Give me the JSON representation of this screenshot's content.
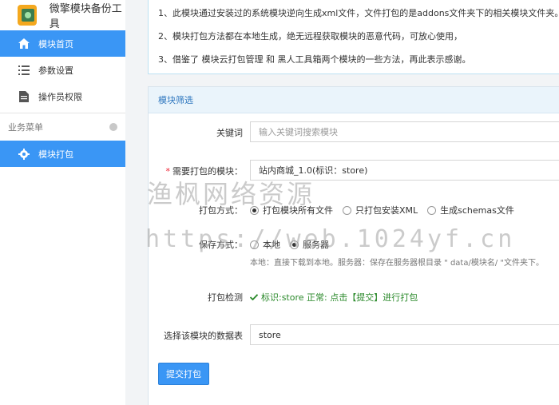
{
  "sidebar": {
    "brand_title": "微擎模块备份工具",
    "items": [
      {
        "label": "模块首页",
        "icon": "home-icon",
        "active": true
      },
      {
        "label": "参数设置",
        "icon": "list-icon",
        "active": false
      },
      {
        "label": "操作员权限",
        "icon": "document-icon",
        "active": false
      }
    ],
    "section_label": "业务菜单",
    "section_items": [
      {
        "label": "模块打包",
        "icon": "gear-icon",
        "active": true
      }
    ],
    "accent_color": "#3a96f5"
  },
  "notice": {
    "lines": [
      "1、此模块通过安装过的系统模块逆向生成xml文件，文件打包的是addons文件夹下的相关模块文件夹。",
      "2、模块打包方法都在本地生成，绝无远程获取模块的恶意代码，可放心使用，",
      "3、借鉴了 模块云打包管理 和 黑人工具箱两个模块的一些方法，再此表示感谢。"
    ]
  },
  "panel": {
    "title": "模块筛选",
    "keyword_label": "关键词",
    "keyword_placeholder": "输入关键词搜索模块",
    "module_required_mark": "*",
    "module_label": "需要打包的模块：",
    "module_value": "站内商城_1.0(标识：store)",
    "pack_label": "打包方式：",
    "pack_options": [
      {
        "label": "打包模块所有文件",
        "checked": true
      },
      {
        "label": "只打包安装XML",
        "checked": false
      },
      {
        "label": "生成schemas文件",
        "checked": false
      }
    ],
    "save_label": "保存方式：",
    "save_options": [
      {
        "label": "本地",
        "checked": false
      },
      {
        "label": "服务器",
        "checked": true
      }
    ],
    "save_help": "本地：直接下载到本地。服务器：保存在服务器根目录 \" data/模块名/ \"文件夹下。",
    "check_label": "打包检测",
    "check_text": "标识:store 正常: 点击【提交】进行打包",
    "table_label": "选择该模块的数据表",
    "table_value": "store",
    "submit_label": "提交打包"
  },
  "watermark": {
    "line1": "渔枫网络资源",
    "line2": "https://web.1024yf.cn"
  }
}
